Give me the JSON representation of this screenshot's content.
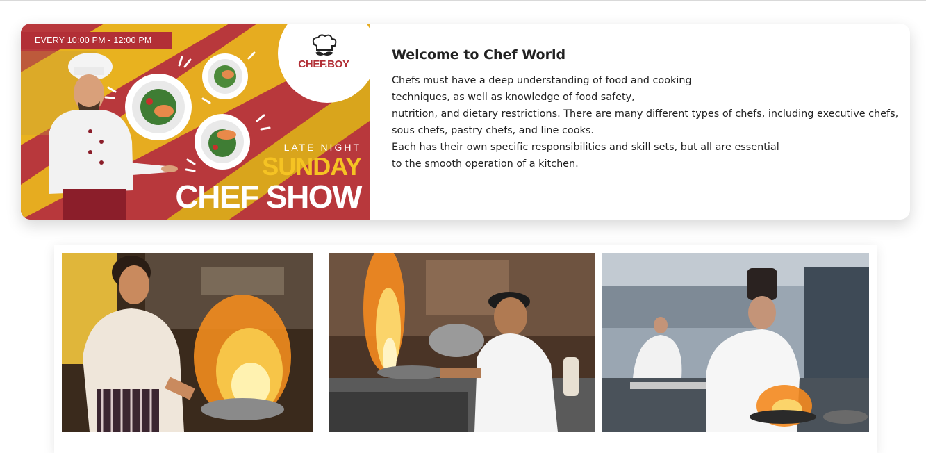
{
  "banner": {
    "time": "EVERY 10:00 PM - 12:00 PM",
    "logo_text": "CHEF.BOY",
    "late_night": "LATE NIGHT",
    "sunday": "SUNDAY",
    "chef_show": "CHEF SHOW"
  },
  "welcome": {
    "title": "Welcome to Chef World",
    "lines": [
      "Chefs must have a deep understanding of food and cooking",
      "techniques, as well as knowledge of food safety,",
      "nutrition, and dietary restrictions. There are many different types of chefs, including executive chefs,",
      "sous chefs, pastry chefs, and line cooks.",
      "Each has their own specific responsibilities and skill sets, but all are essential",
      "to the smooth operation of a kitchen."
    ]
  },
  "colors": {
    "banner_red": "#b8383c",
    "banner_yellow": "#f5c323",
    "logo_red": "#b22f36"
  }
}
